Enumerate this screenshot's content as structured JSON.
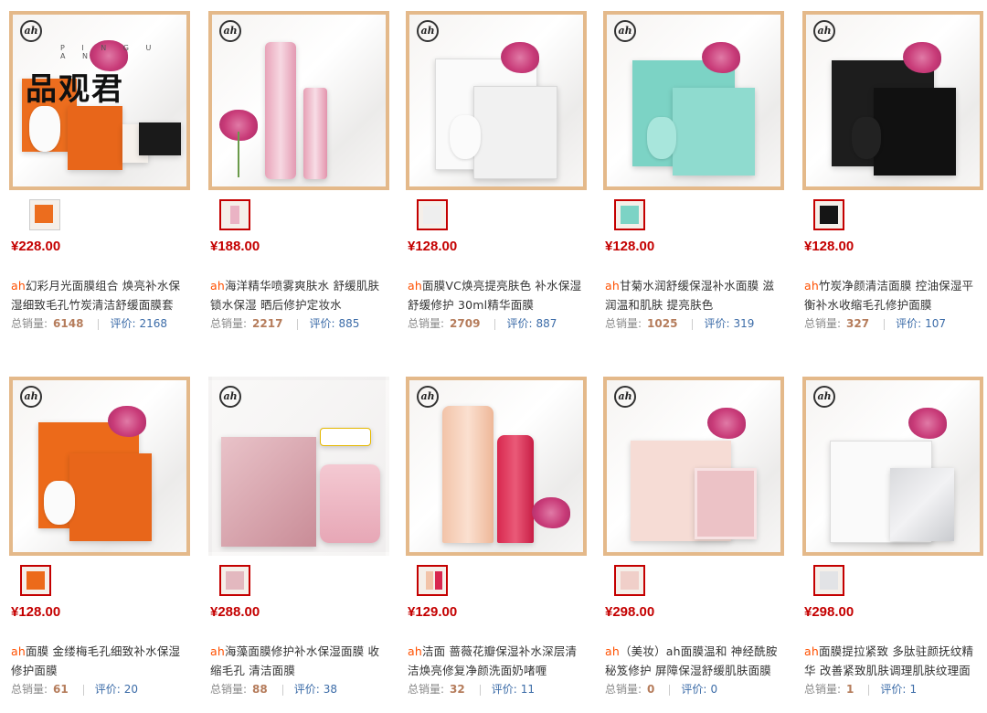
{
  "watermark": {
    "text": "品观君",
    "small": "P I N G U A N"
  },
  "products": [
    {
      "price": "¥228.00",
      "brand": "ah",
      "title": "幻彩月光面膜组合 焕亮补水保湿细致毛孔竹炭清洁舒缓面膜套",
      "sales_label": "总销量:",
      "sales": "6148",
      "review_label": "评价:",
      "reviews": "2168"
    },
    {
      "price": "¥188.00",
      "brand": "ah",
      "title": "海洋精华喷雾爽肤水 舒缓肌肤锁水保湿 晒后修护定妆水",
      "sales_label": "总销量:",
      "sales": "2217",
      "review_label": "评价:",
      "reviews": "885"
    },
    {
      "price": "¥128.00",
      "brand": "ah",
      "title": "面膜VC焕亮提亮肤色 补水保湿舒缓修护 30ml精华面膜",
      "sales_label": "总销量:",
      "sales": "2709",
      "review_label": "评价:",
      "reviews": "887"
    },
    {
      "price": "¥128.00",
      "brand": "ah",
      "title": "甘菊水润舒缓保湿补水面膜 滋润温和肌肤 提亮肤色",
      "sales_label": "总销量:",
      "sales": "1025",
      "review_label": "评价:",
      "reviews": "319"
    },
    {
      "price": "¥128.00",
      "brand": "ah",
      "title": "竹炭净颜清洁面膜 控油保湿平衡补水收缩毛孔修护面膜",
      "sales_label": "总销量:",
      "sales": "327",
      "review_label": "评价:",
      "reviews": "107"
    },
    {
      "price": "¥128.00",
      "brand": "ah",
      "title": "面膜 金缕梅毛孔细致补水保湿修护面膜",
      "sales_label": "总销量:",
      "sales": "61",
      "review_label": "评价:",
      "reviews": "20"
    },
    {
      "price": "¥288.00",
      "brand": "ah",
      "title": "海藻面膜修护补水保湿面膜 收缩毛孔 清洁面膜",
      "sales_label": "总销量:",
      "sales": "88",
      "review_label": "评价:",
      "reviews": "38"
    },
    {
      "price": "¥129.00",
      "brand": "ah",
      "title": "洁面 蔷薇花瓣保湿补水深层清洁焕亮修复净颜洗面奶啫喱",
      "sales_label": "总销量:",
      "sales": "32",
      "review_label": "评价:",
      "reviews": "11"
    },
    {
      "price": "¥298.00",
      "brand": "ah",
      "title": "（美妆）ah面膜温和 神经酰胺秘笈修护 屏障保湿舒缓肌肤面膜",
      "sales_label": "总销量:",
      "sales": "0",
      "review_label": "评价:",
      "reviews": "0"
    },
    {
      "price": "¥298.00",
      "brand": "ah",
      "title": "面膜提拉紧致 多肽驻颜抚纹精华 改善紧致肌肤调理肌肤纹理面",
      "sales_label": "总销量:",
      "sales": "1",
      "review_label": "评价:",
      "reviews": "1"
    }
  ],
  "colors": {
    "price": "#c40000",
    "brand": "#ff5000",
    "frame": "#e4b98a",
    "review": "#3c6ca8"
  },
  "icons": {
    "logo": "ah-logo-icon",
    "flower": "peony-flower-icon"
  }
}
